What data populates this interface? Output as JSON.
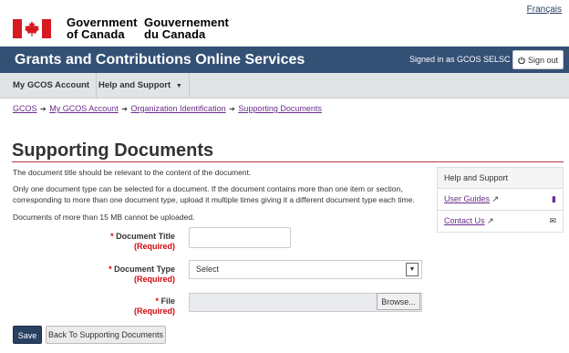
{
  "header": {
    "language_link": "Français",
    "gov_en_line1": "Government",
    "gov_en_line2": "of Canada",
    "gov_fr_line1": "Gouvernement",
    "gov_fr_line2": "du Canada",
    "colors": {
      "flag_red": "#d71920",
      "app_bar": "#335075"
    }
  },
  "app_bar": {
    "title": "Grants and Contributions Online Services",
    "signed_in_text": "Signed in as GCOS SELSC",
    "signout_label": "Sign out",
    "signout_icon": "power-icon"
  },
  "menu": {
    "items": [
      {
        "label": "My GCOS Account"
      },
      {
        "label": "Help and Support",
        "icon": "chevron-down-icon"
      }
    ]
  },
  "breadcrumb": {
    "items": [
      "GCOS",
      "My GCOS Account",
      "Organization Identification",
      "Supporting Documents"
    ],
    "separator_icon": "arrow-right-icon"
  },
  "page": {
    "title": "Supporting Documents",
    "p1": "The document title should be relevant to the content of the document.",
    "p2": "Only one document type can be selected for a document. If the document contains more than one item or section, corresponding to more than one document type, upload it multiple times giving it a different document type each time.",
    "p3": "Documents of more than 15 MB cannot be uploaded."
  },
  "side_panel": {
    "heading": "Help and Support",
    "links": [
      {
        "label": "User Guides",
        "external_icon": "external-link-icon",
        "icon": "book-icon"
      },
      {
        "label": "Contact Us",
        "external_icon": "external-link-icon",
        "icon": "envelope-icon"
      }
    ]
  },
  "form": {
    "required_marker": "*",
    "required_text": "(Required)",
    "document_title": {
      "label": "Document Title",
      "value": ""
    },
    "document_type": {
      "label": "Document Type",
      "selected": "Select"
    },
    "file": {
      "label": "File",
      "browse_label": "Browse..."
    },
    "save_label": "Save",
    "back_label": "Back To Supporting Documents"
  }
}
